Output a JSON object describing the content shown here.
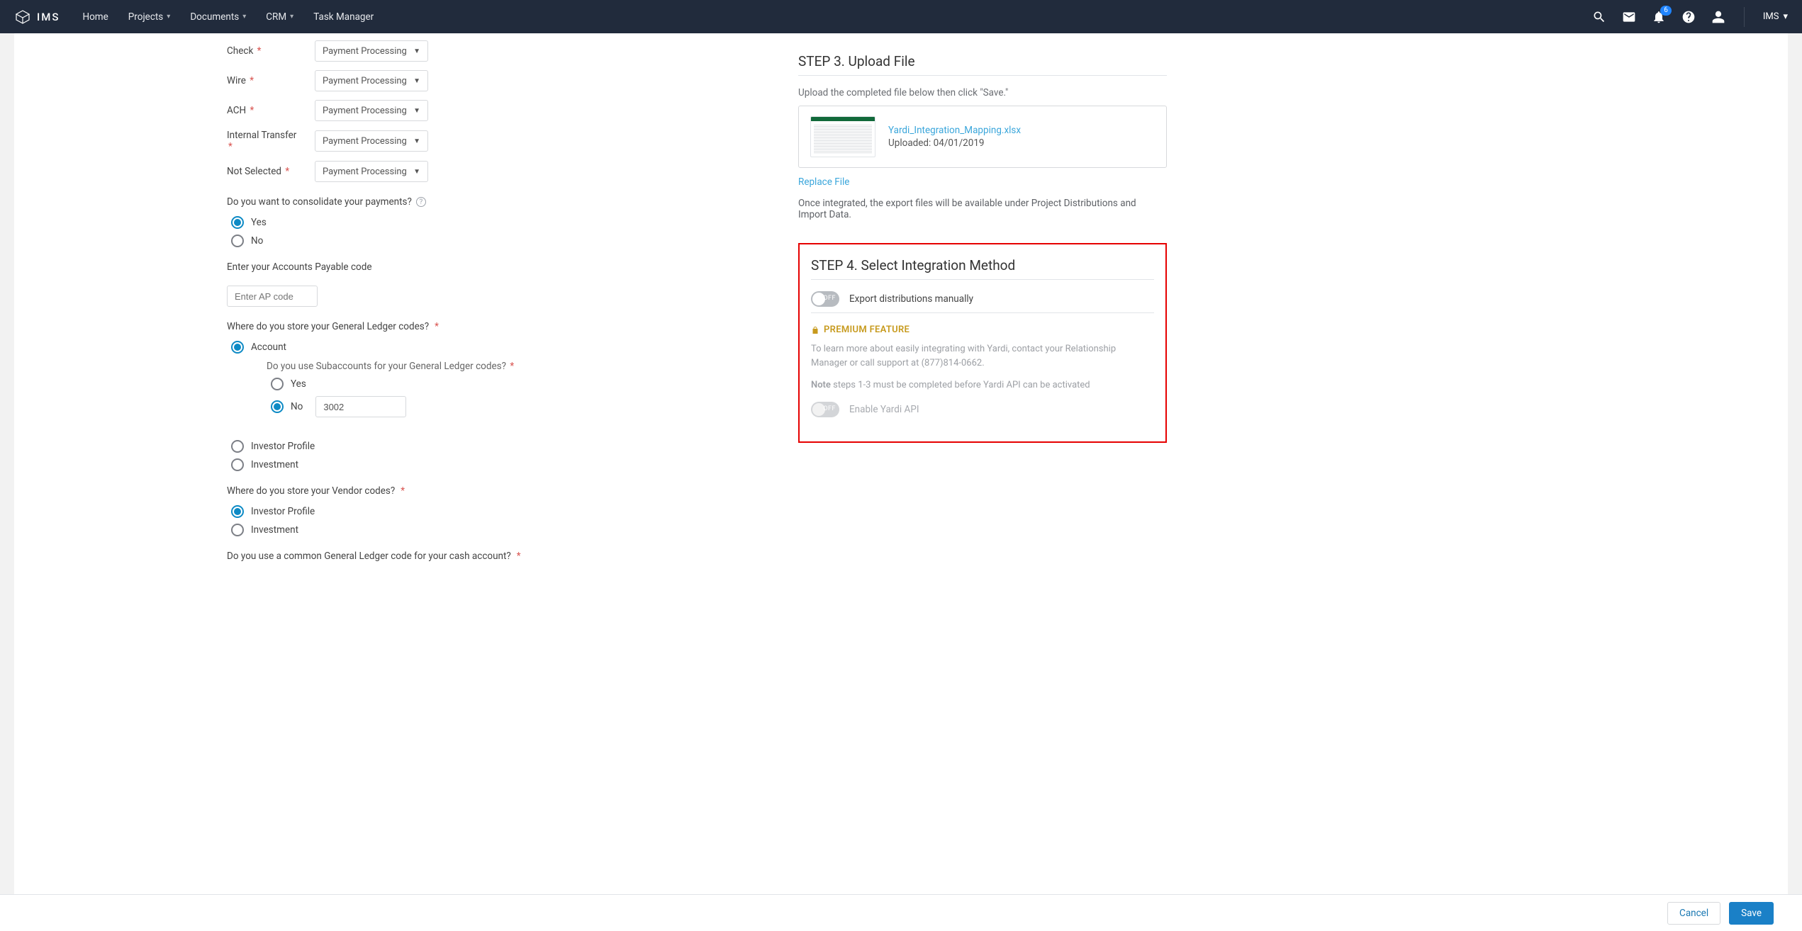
{
  "nav": {
    "brand": "IMS",
    "items": [
      {
        "label": "Home",
        "hasMenu": false
      },
      {
        "label": "Projects",
        "hasMenu": true
      },
      {
        "label": "Documents",
        "hasMenu": true
      },
      {
        "label": "CRM",
        "hasMenu": true
      },
      {
        "label": "Task Manager",
        "hasMenu": false
      }
    ],
    "badge": "6",
    "orgLabel": "IMS"
  },
  "left": {
    "paymentFields": [
      {
        "label": "Check",
        "value": "Payment Processing"
      },
      {
        "label": "Wire",
        "value": "Payment Processing"
      },
      {
        "label": "ACH",
        "value": "Payment Processing"
      },
      {
        "label": "Internal Transfer",
        "value": "Payment Processing"
      },
      {
        "label": "Not Selected",
        "value": "Payment Processing"
      }
    ],
    "consolidateQ": "Do you want to consolidate your payments?",
    "consolidateYes": "Yes",
    "consolidateNo": "No",
    "apLabel": "Enter your Accounts Payable code",
    "apPlaceholder": "Enter AP code",
    "glQ": "Where do you store your General Ledger codes?",
    "glOptions": {
      "account": "Account",
      "investorProfile": "Investor Profile",
      "investment": "Investment"
    },
    "subacctQ": "Do you use Subaccounts for your General Ledger codes?",
    "subYes": "Yes",
    "subNo": "No",
    "subNoValue": "3002",
    "vendorQ": "Where do you store your Vendor codes?",
    "vendorOptions": {
      "investorProfile": "Investor Profile",
      "investment": "Investment"
    },
    "cashQ": "Do you use a common General Ledger code for your cash account?"
  },
  "step3": {
    "title": "STEP 3. Upload File",
    "desc": "Upload the completed file below then click \"Save.\"",
    "fileName": "Yardi_Integration_Mapping.xlsx",
    "uploaded": "Uploaded: 04/01/2019",
    "replace": "Replace File",
    "after": "Once integrated, the export files will be available under Project Distributions and Import Data."
  },
  "step4": {
    "title": "STEP 4. Select Integration Method",
    "toggle1Txt": "OFF",
    "toggle1Label": "Export distributions manually",
    "premium": "PREMIUM FEATURE",
    "premText": "To learn more about easily integrating with Yardi, contact your Relationship Manager or call support at (877)814-0662.",
    "noteLabel": "Note",
    "noteText": " steps 1-3 must be completed before Yardi API can be activated",
    "toggle2Txt": "OFF",
    "toggle2Label": "Enable Yardi API"
  },
  "footer": {
    "cancel": "Cancel",
    "save": "Save"
  }
}
